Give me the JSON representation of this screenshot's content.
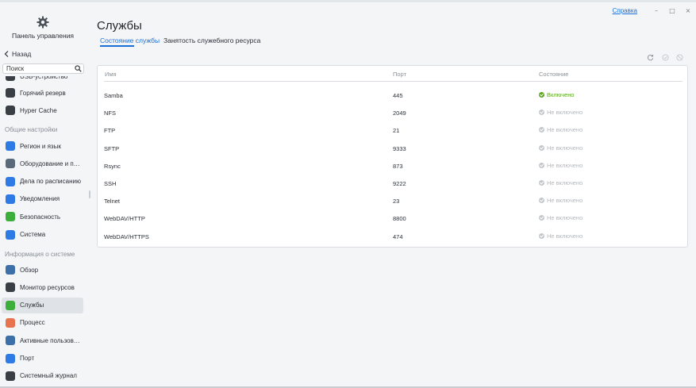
{
  "window": {
    "help_link": "Справка",
    "min": "–",
    "max": "□",
    "close": "×"
  },
  "sidebar": {
    "app_title": "Панель управления",
    "back_label": "Назад",
    "search_placeholder": "Поиск",
    "partial_item": "USB-устройство",
    "items_a": [
      {
        "label": "Горячий резерв",
        "icon": "hot-standby-icon",
        "color": "#3a3f46"
      },
      {
        "label": "Hyper Cache",
        "icon": "hyper-cache-icon",
        "color": "#3a3f46"
      }
    ],
    "section_general": "Общие настройки",
    "items_b": [
      {
        "label": "Регион и язык",
        "icon": "globe-icon",
        "color": "#2f7be5"
      },
      {
        "label": "Оборудование и пит...",
        "icon": "hardware-icon",
        "color": "#5a6a7a"
      },
      {
        "label": "Дела по расписанию",
        "icon": "schedule-icon",
        "color": "#2f7be5"
      },
      {
        "label": "Уведомления",
        "icon": "notifications-icon",
        "color": "#2f7be5"
      },
      {
        "label": "Безопасность",
        "icon": "security-icon",
        "color": "#3cae3c"
      },
      {
        "label": "Система",
        "icon": "system-icon",
        "color": "#2f7be5"
      }
    ],
    "section_info": "Информация о системе",
    "items_c": [
      {
        "label": "Обзор",
        "icon": "overview-icon",
        "color": "#3d6fa8"
      },
      {
        "label": "Монитор ресурсов",
        "icon": "resource-monitor-icon",
        "color": "#3a3f46"
      },
      {
        "label": "Службы",
        "icon": "services-icon",
        "color": "#3cae3c"
      },
      {
        "label": "Процесс",
        "icon": "process-icon",
        "color": "#e8744f"
      },
      {
        "label": "Активные пользоват...",
        "icon": "active-users-icon",
        "color": "#3d6fa8"
      },
      {
        "label": "Порт",
        "icon": "port-icon",
        "color": "#2f7be5"
      },
      {
        "label": "Системный журнал",
        "icon": "system-log-icon",
        "color": "#3a3f46"
      }
    ]
  },
  "main": {
    "title": "Службы",
    "tabs": [
      "Состояние службы",
      "Занятость служебного ресурса"
    ],
    "table": {
      "headers": [
        "Имя",
        "Порт",
        "Состояние"
      ],
      "rows": [
        {
          "name": "Samba",
          "port": "445",
          "status": "Включено",
          "on": true
        },
        {
          "name": "NFS",
          "port": "2049",
          "status": "Не включено",
          "on": false
        },
        {
          "name": "FTP",
          "port": "21",
          "status": "Не включено",
          "on": false
        },
        {
          "name": "SFTP",
          "port": "9333",
          "status": "Не включено",
          "on": false
        },
        {
          "name": "Rsync",
          "port": "873",
          "status": "Не включено",
          "on": false
        },
        {
          "name": "SSH",
          "port": "9222",
          "status": "Не включено",
          "on": false
        },
        {
          "name": "Telnet",
          "port": "23",
          "status": "Не включено",
          "on": false
        },
        {
          "name": "WebDAV/HTTP",
          "port": "8800",
          "status": "Не включено",
          "on": false
        },
        {
          "name": "WebDAV/HTTPS",
          "port": "474",
          "status": "Не включено",
          "on": false
        }
      ]
    }
  }
}
